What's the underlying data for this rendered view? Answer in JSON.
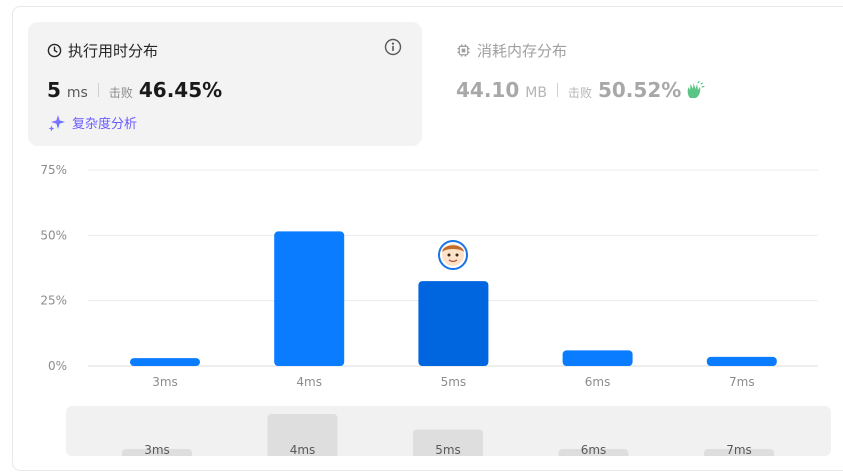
{
  "runtime": {
    "title": "执行用时分布",
    "value": "5",
    "unit": "ms",
    "beat_label": "击败",
    "beat_pct": "46.45%",
    "analysis_label": "复杂度分析"
  },
  "memory": {
    "title": "消耗内存分布",
    "value": "44.10",
    "unit": "MB",
    "beat_label": "击败",
    "beat_pct": "50.52%"
  },
  "icons": {
    "runtime": "clock-icon",
    "info": "info-icon",
    "analysis": "sparkle-icon",
    "memory": "chip-icon",
    "clap": "clap-icon",
    "user": "avatar"
  },
  "colors": {
    "bar": "#0a7cff",
    "bar_active": "#0066e0",
    "analysis": "#6b5bff",
    "clap": "#3dbb6e"
  },
  "chart_data": {
    "type": "bar",
    "categories": [
      "3ms",
      "4ms",
      "5ms",
      "6ms",
      "7ms"
    ],
    "values": [
      3,
      51.5,
      32.5,
      6,
      3.5
    ],
    "active_category": "5ms",
    "y_ticks": [
      "0%",
      "25%",
      "50%",
      "75%"
    ],
    "ylim": [
      0,
      75
    ],
    "grid": true
  },
  "range_selector": {
    "labels": [
      "3ms",
      "4ms",
      "5ms",
      "6ms",
      "7ms"
    ]
  }
}
